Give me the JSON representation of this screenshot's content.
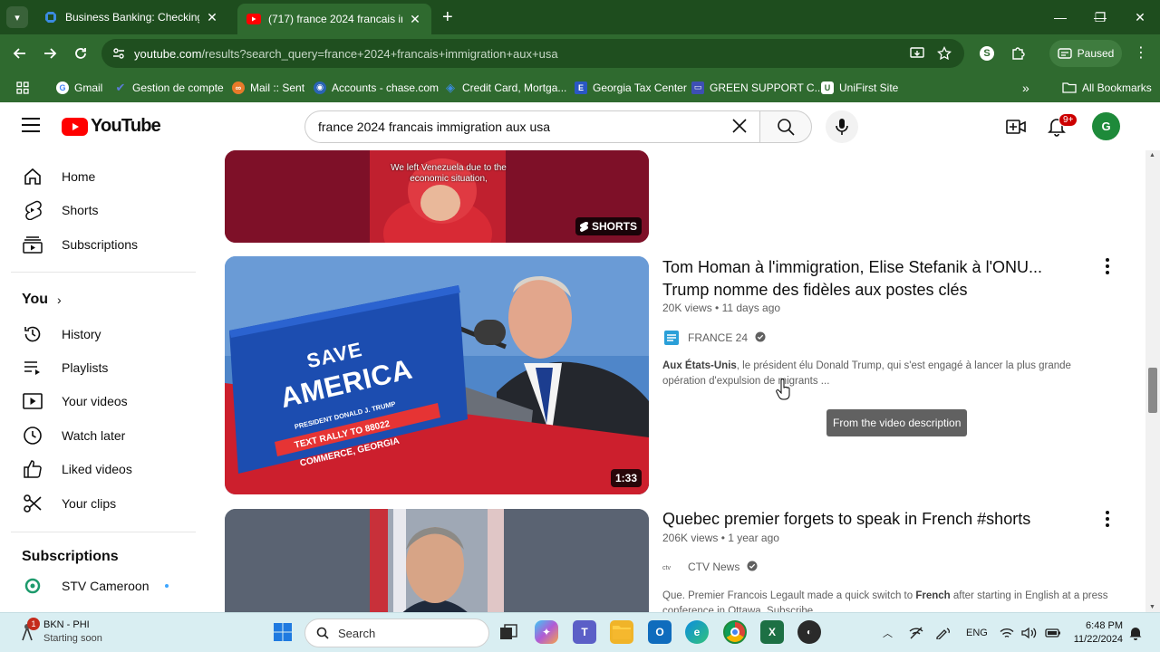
{
  "browser": {
    "tabs": [
      {
        "title": "Business Banking: Checking, Sa",
        "active": false
      },
      {
        "title": "(717) france 2024 francais imm",
        "active": true
      }
    ],
    "url_host": "youtube.com",
    "url_path": "/results?search_query=france+2024+francais+immigration+aux+usa",
    "profile_label": "Paused",
    "bookmarks": [
      {
        "label": "Gmail"
      },
      {
        "label": "Gestion de compte"
      },
      {
        "label": "Mail :: Sent"
      },
      {
        "label": "Accounts - chase.com"
      },
      {
        "label": "Credit Card, Mortga..."
      },
      {
        "label": "Georgia Tax Center"
      },
      {
        "label": "GREEN SUPPORT C..."
      },
      {
        "label": "UniFirst Site"
      }
    ],
    "all_bookmarks_label": "All Bookmarks"
  },
  "youtube": {
    "logo_text": "YouTube",
    "search_query": "france 2024 francais immigration aux usa",
    "notification_count": "9+",
    "sidebar": {
      "main": [
        {
          "label": "Home"
        },
        {
          "label": "Shorts"
        },
        {
          "label": "Subscriptions"
        }
      ],
      "you_label": "You",
      "you_items": [
        {
          "label": "History"
        },
        {
          "label": "Playlists"
        },
        {
          "label": "Your videos"
        },
        {
          "label": "Watch later"
        },
        {
          "label": "Liked videos"
        },
        {
          "label": "Your clips"
        }
      ],
      "subscriptions_label": "Subscriptions",
      "subscriptions": [
        {
          "label": "STV Cameroon"
        }
      ]
    },
    "results": [
      {
        "caption": "We left Venezuela due to the economic situation,",
        "badge": "SHORTS"
      },
      {
        "title": "Tom Homan à l'immigration, Elise Stefanik à l'ONU... Trump nomme des fidèles aux postes clés",
        "views": "20K views",
        "age": "11 days ago",
        "channel": "FRANCE 24",
        "desc_bold": "Aux États-Unis",
        "desc_rest": ", le président élu Donald Trump, qui s'est engagé à lancer la plus grande opération d'expulsion de migrants ...",
        "duration": "1:33",
        "sign_save": "SAVE",
        "sign_america": "AMERICA",
        "sign_president": "PRESIDENT DONALD J. TRUMP",
        "sign_text": "TEXT RALLY TO 88022",
        "sign_place": "COMMERCE, GEORGIA",
        "tooltip": "From the video description"
      },
      {
        "title": "Quebec premier forgets to speak in French #shorts",
        "views": "206K views",
        "age": "1 year ago",
        "channel": "CTV News",
        "desc_pre": "Que. Premier Francois Legault made a quick switch to ",
        "desc_bold": "French",
        "desc_rest": " after starting in English at a press conference in Ottawa. Subscribe"
      }
    ]
  },
  "taskbar": {
    "weather_title": "BKN - PHI",
    "weather_status": "Starting soon",
    "weather_badge": "1",
    "search_placeholder": "Search",
    "language": "ENG",
    "time": "6:48 PM",
    "date": "11/22/2024"
  },
  "colors": {
    "chrome_dark": "#1e4d1e",
    "chrome": "#2f6a2f",
    "youtube_red": "#ff0000",
    "taskbar": "#d9eef2"
  }
}
